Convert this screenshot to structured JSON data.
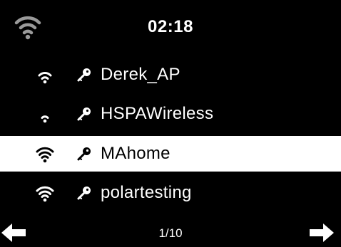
{
  "status": {
    "time": "02:18",
    "wifi_icon": "wifi-strength-icon",
    "wifi_color": "#9a9a9a"
  },
  "networks": [
    {
      "ssid": "Derek_AP",
      "signal_bars": 3,
      "secured": true,
      "selected": false
    },
    {
      "ssid": "HSPAWireless",
      "signal_bars": 2,
      "secured": true,
      "selected": false
    },
    {
      "ssid": "MAhome",
      "signal_bars": 4,
      "secured": true,
      "selected": true
    },
    {
      "ssid": "polartesting",
      "signal_bars": 4,
      "secured": true,
      "selected": false
    }
  ],
  "footer": {
    "page_indicator": "1/10",
    "left_icon": "arrow-left-icon",
    "right_icon": "arrow-right-icon"
  },
  "colors": {
    "background": "#000000",
    "text": "#ffffff",
    "selected_background": "#ffffff",
    "selected_text": "#000000"
  }
}
